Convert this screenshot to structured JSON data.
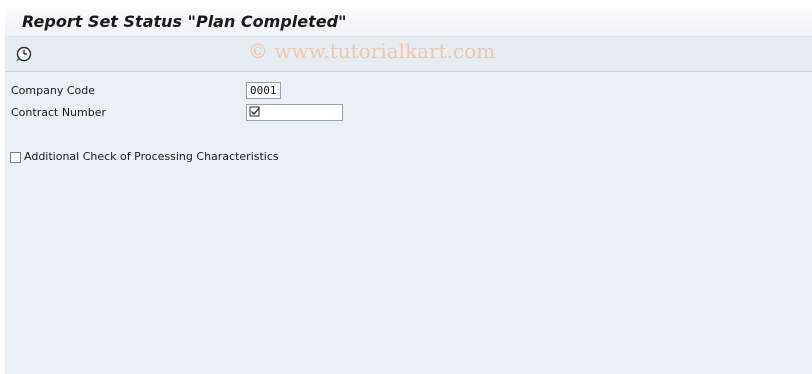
{
  "window": {
    "title": "Report Set Status \"Plan Completed\""
  },
  "toolbar": {
    "execute_icon": "execute-clock-icon",
    "watermark": "© www.tutorialkart.com"
  },
  "form": {
    "company_code": {
      "label": "Company Code",
      "value": "0001"
    },
    "contract_number": {
      "label": "Contract Number",
      "value": "",
      "required_icon": "required-check-icon"
    },
    "additional_check": {
      "label": "Additional Check of Processing Characteristics",
      "checked": false
    }
  },
  "colors": {
    "content_bg": "#eaf0f6",
    "toolbar_bg": "#e6ecf2",
    "field_border": "#8ea2b8"
  }
}
